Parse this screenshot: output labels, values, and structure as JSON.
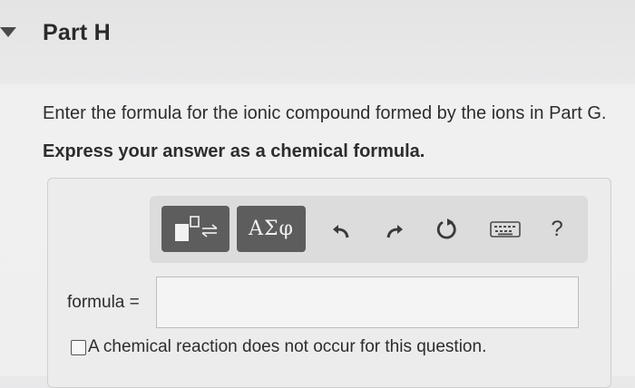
{
  "part": {
    "title": "Part H"
  },
  "question": {
    "instruction": "Enter the formula for the ionic compound formed by the ions in Part G.",
    "express": "Express your answer as a chemical formula."
  },
  "toolbar": {
    "greek_label": "ΑΣφ",
    "help_label": "?",
    "icons": [
      "templates-icon",
      "undo-icon",
      "redo-icon",
      "reset-icon",
      "keyboard-icon",
      "help-icon"
    ]
  },
  "answer": {
    "label": "formula =",
    "value": ""
  },
  "no_reaction": {
    "label": "A chemical reaction does not occur for this question.",
    "checked": false
  },
  "colors": {
    "toolbar_button": "#5d5d5d",
    "toolbar_background": "#dcdcdc",
    "icon_dark": "#3a3a3a"
  }
}
